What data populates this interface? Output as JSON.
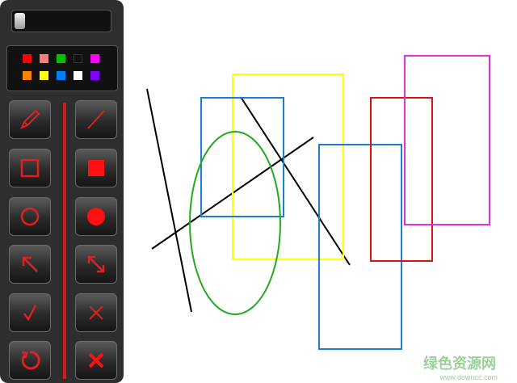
{
  "toolbar": {
    "palette_colors": [
      "#ff0000",
      "#ff7a7a",
      "#00c000",
      "#111111",
      "#ff00ff",
      "#ff8000",
      "#ffff00",
      "#0080ff",
      "#ffffff",
      "#8000ff"
    ],
    "tools": [
      "pencil",
      "line",
      "rectangle",
      "filled-rectangle",
      "ellipse",
      "filled-ellipse",
      "arrow",
      "resize",
      "check",
      "cross",
      "undo",
      "close"
    ],
    "accent": "#d41a1a"
  },
  "canvas": {
    "stroke_colors": [
      "#000000",
      "#1a7fd4",
      "#ffff00",
      "#22aa22",
      "#dd1111",
      "#dd33dd"
    ]
  },
  "watermark": {
    "text": "绿色资源网",
    "url": "www.downcc.com"
  }
}
